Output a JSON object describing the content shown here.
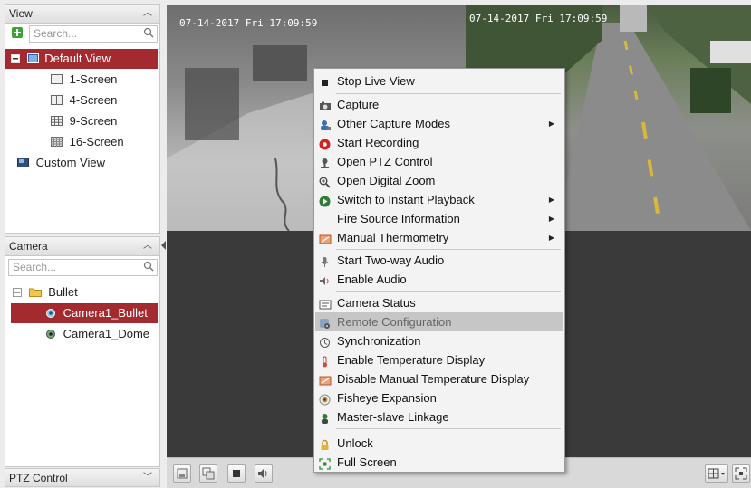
{
  "view_panel": {
    "title": "View",
    "search_placeholder": "Search...",
    "items": [
      {
        "label": "Default View"
      },
      {
        "label": "1-Screen"
      },
      {
        "label": "4-Screen"
      },
      {
        "label": "9-Screen"
      },
      {
        "label": "16-Screen"
      },
      {
        "label": "Custom View"
      }
    ]
  },
  "camera_panel": {
    "title": "Camera",
    "search_placeholder": "Search...",
    "group": "Bullet",
    "cameras": [
      {
        "label": "Camera1_Bullet"
      },
      {
        "label": "Camera1_Dome"
      }
    ]
  },
  "ptz_panel": {
    "title": "PTZ Control"
  },
  "video": {
    "timestamp_left": "07-14-2017 Fri 17:09:59",
    "timestamp_right": "07-14-2017 Fri 17:09:59"
  },
  "context_menu": {
    "items": [
      {
        "label": "Stop Live View",
        "icon": "stop-icon"
      },
      {
        "label": "Capture",
        "icon": "camera-icon"
      },
      {
        "label": "Other Capture Modes",
        "icon": "user-capture-icon",
        "submenu": true
      },
      {
        "label": "Start Recording",
        "icon": "record-icon"
      },
      {
        "label": "Open PTZ Control",
        "icon": "ptz-icon"
      },
      {
        "label": "Open Digital Zoom",
        "icon": "zoom-icon"
      },
      {
        "label": "Switch to Instant Playback",
        "icon": "playback-icon",
        "submenu": true
      },
      {
        "label": "Fire Source Information",
        "icon": "",
        "submenu": true
      },
      {
        "label": "Manual Thermometry",
        "icon": "thermometry-icon",
        "submenu": true
      },
      {
        "label": "Start Two-way Audio",
        "icon": "microphone-icon"
      },
      {
        "label": "Enable Audio",
        "icon": "speaker-icon"
      },
      {
        "label": "Camera Status",
        "icon": "status-icon"
      },
      {
        "label": "Remote Configuration",
        "icon": "config-icon"
      },
      {
        "label": "Synchronization",
        "icon": "sync-icon"
      },
      {
        "label": "Enable Temperature Display",
        "icon": "thermometer-icon"
      },
      {
        "label": "Disable Manual Temperature Display",
        "icon": "temp-display-icon"
      },
      {
        "label": "Fisheye Expansion",
        "icon": "fisheye-icon"
      },
      {
        "label": "Master-slave Linkage",
        "icon": "linkage-icon"
      },
      {
        "label": "Unlock",
        "icon": "lock-icon"
      },
      {
        "label": "Full Screen",
        "icon": "fullscreen-icon"
      }
    ]
  },
  "colors": {
    "selection": "#a32a2e",
    "menu_highlight": "#c6c6c6"
  }
}
